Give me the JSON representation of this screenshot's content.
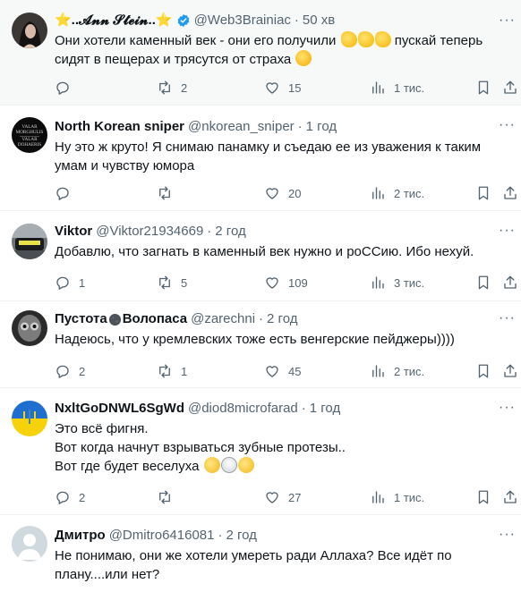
{
  "tweets": [
    {
      "name": "⭐..𝓐𝓷𝓷 𝓢𝓽𝓮𝓲𝓷..⭐",
      "handle": "@Web3Brainiac",
      "time": "50 хв",
      "lines": [
        "Они хотели каменный век - они его получили",
        "сидят в пещерах и трясутся от страха"
      ],
      "line1_after_emoji": " пускай теперь",
      "reply": "",
      "retweets": "2",
      "likes": "15",
      "views": "1 тис."
    },
    {
      "name": "North Korean sniper",
      "handle": "@nkorean_sniper",
      "time": "1 год",
      "lines": [
        "Ну это ж круто! Я снимаю панамку и съедаю ее из уважения к таким",
        "умам и чувству юмора"
      ],
      "reply": "",
      "retweets": "",
      "likes": "20",
      "views": "2 тис."
    },
    {
      "name": "Viktor",
      "handle": "@Viktor21934669",
      "time": "2 год",
      "lines": [
        "Добавлю, что загнать в каменный век нужно и роССию. Ибо нехуй."
      ],
      "reply": "1",
      "retweets": "5",
      "likes": "109",
      "views": "3 тис."
    },
    {
      "name": "Пустота",
      "name2": "Волопаса",
      "handle": "@zarechni",
      "time": "2 год",
      "lines": [
        "Надеюсь, что у кремлевских тоже есть венгерские пейджеры))))"
      ],
      "reply": "2",
      "retweets": "1",
      "likes": "45",
      "views": "2 тис."
    },
    {
      "name": "NxltGoDNWL6SgWd",
      "handle": "@diod8microfarad",
      "time": "1 год",
      "lines": [
        "Это всё фигня.",
        "Вот когда начнут взрываться зубные протезы..",
        "Вот где будет веселуха"
      ],
      "reply": "2",
      "retweets": "",
      "likes": "27",
      "views": "1 тис."
    },
    {
      "name": "Дмитро",
      "handle": "@Dmitro6416081",
      "time": "2 год",
      "lines": [
        "Не понимаю, они же хотели умереть ради Аллаха? Все идёт по",
        "плану....или нет?"
      ]
    }
  ],
  "avatar_texts": {
    "northkorean": [
      "VALAR",
      "MORGHULIS",
      "VALAR",
      "DOHAERIS"
    ]
  },
  "colors": {
    "text": "#0f1419",
    "secondary": "#536471",
    "verified": "#1d9bf0",
    "highlight_bg": "#f7f9f9",
    "divider": "#eff3f4"
  },
  "icons": [
    "reply-icon",
    "retweet-icon",
    "like-icon",
    "views-icon",
    "bookmark-icon",
    "share-icon",
    "more-icon",
    "verified-icon"
  ]
}
